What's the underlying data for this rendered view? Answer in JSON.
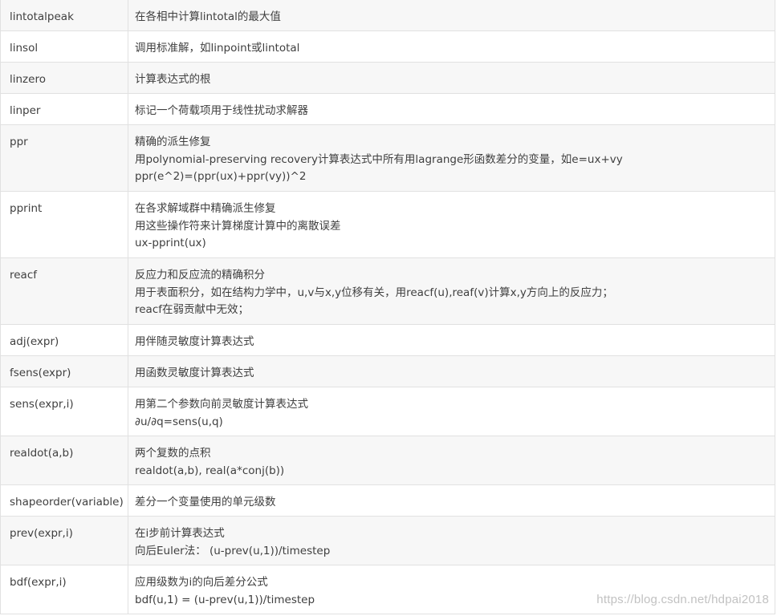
{
  "rows": [
    {
      "name": "lintotalpeak",
      "lines": [
        "在各相中计算lintotal的最大值"
      ]
    },
    {
      "name": "linsol",
      "lines": [
        "调用标准解，如linpoint或lintotal"
      ]
    },
    {
      "name": "linzero",
      "lines": [
        "计算表达式的根"
      ]
    },
    {
      "name": "linper",
      "lines": [
        "标记一个荷载项用于线性扰动求解器"
      ]
    },
    {
      "name": "ppr",
      "lines": [
        "精确的派生修复",
        "用polynomial-preserving recovery计算表达式中所有用lagrange形函数差分的变量，如e=ux+vy",
        "ppr(e^2)=(ppr(ux)+ppr(vy))^2"
      ]
    },
    {
      "name": "pprint",
      "lines": [
        "在各求解域群中精确派生修复",
        "用这些操作符来计算梯度计算中的离散误差",
        "ux-pprint(ux)"
      ]
    },
    {
      "name": "reacf",
      "lines": [
        "反应力和反应流的精确积分",
        "用于表面积分，如在结构力学中，u,v与x,y位移有关，用reacf(u),reaf(v)计算x,y方向上的反应力；",
        "reacf在弱贡献中无效；"
      ]
    },
    {
      "name": "adj(expr)",
      "lines": [
        "用伴随灵敏度计算表达式"
      ]
    },
    {
      "name": "fsens(expr)",
      "lines": [
        "用函数灵敏度计算表达式"
      ]
    },
    {
      "name": "sens(expr,i)",
      "lines": [
        "用第二个参数向前灵敏度计算表达式",
        "∂u/∂q=sens(u,q)"
      ]
    },
    {
      "name": "realdot(a,b)",
      "lines": [
        "两个复数的点积",
        "realdot(a,b), real(a*conj(b))"
      ]
    },
    {
      "name": "shapeorder(variable)",
      "lines": [
        "差分一个变量使用的单元级数"
      ]
    },
    {
      "name": "prev(expr,i)",
      "lines": [
        "在i步前计算表达式",
        "向后Euler法： (u-prev(u,1))/timestep"
      ]
    },
    {
      "name": "bdf(expr,i)",
      "lines": [
        "应用级数为i的向后差分公式",
        "bdf(u,1) = (u-prev(u,1))/timestep"
      ]
    }
  ],
  "watermark": "https://blog.csdn.net/hdpai2018"
}
